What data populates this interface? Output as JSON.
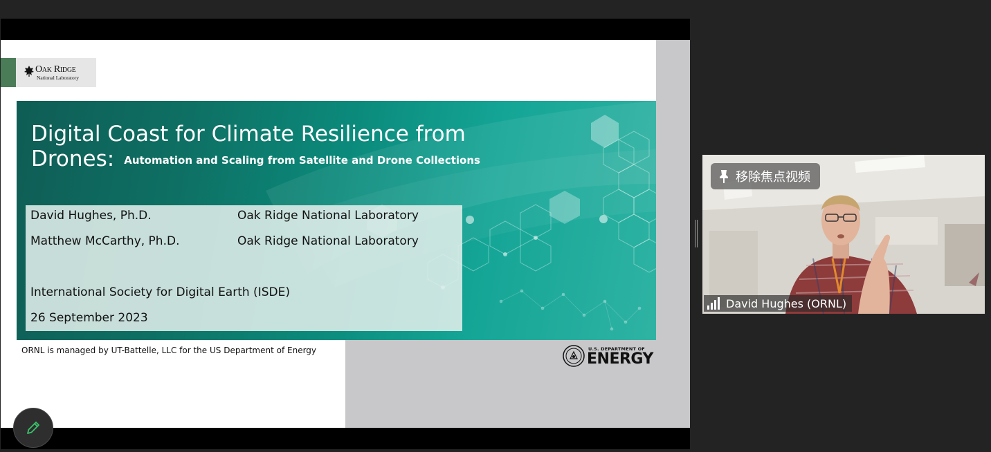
{
  "slide": {
    "logo": {
      "name": "Oak Ridge",
      "subtitle": "National Laboratory"
    },
    "title_line1": "Digital Coast for Climate Resilience from",
    "title_line2": "Drones:",
    "subtitle": "Automation and Scaling from Satellite and Drone Collections",
    "authors": [
      {
        "name": "David Hughes, Ph.D.",
        "org": "Oak Ridge National Laboratory"
      },
      {
        "name": "Matthew McCarthy, Ph.D.",
        "org": "Oak Ridge National Laboratory"
      }
    ],
    "event": "International Society for Digital Earth (ISDE)",
    "date": "26 September 2023",
    "footer": "ORNL is managed by UT-Battelle, LLC for the US Department of Energy",
    "doe_small": "U.S. DEPARTMENT OF",
    "doe_big": "ENERGY"
  },
  "video": {
    "unpin_label": "移除焦点视频",
    "participant_name": "David Hughes (ORNL)"
  },
  "colors": {
    "background": "#232323",
    "ornl_green": "#4a7d57",
    "banner_teal": "#0b8a7b"
  },
  "icons": {
    "annotate": "pencil-icon",
    "unpin": "pin-icon",
    "signal": "signal-bars-icon"
  }
}
